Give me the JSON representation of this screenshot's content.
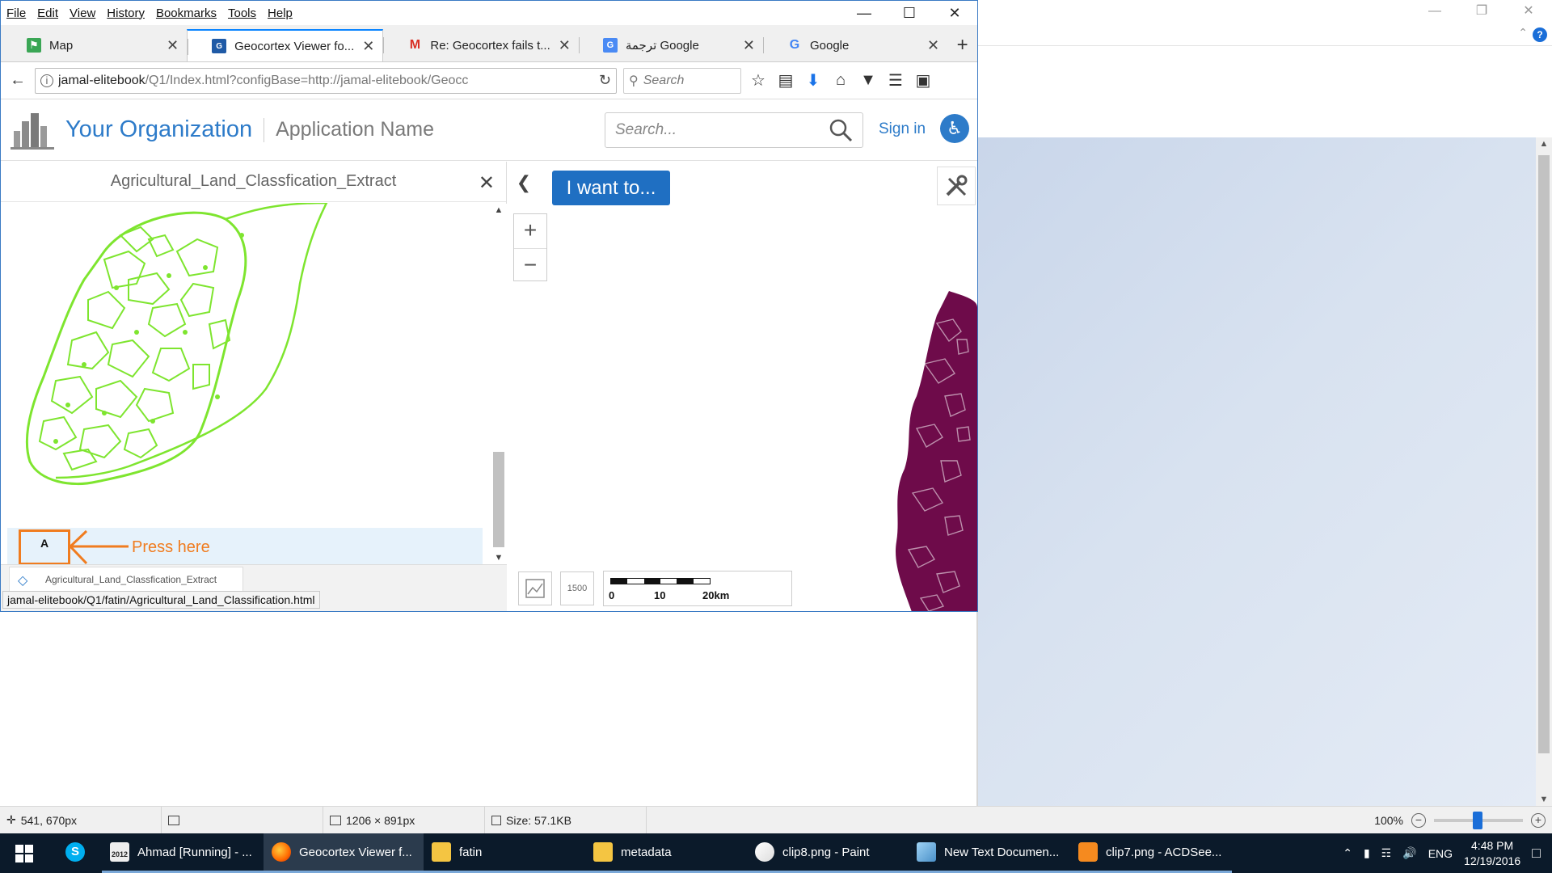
{
  "firefox": {
    "menu": [
      "File",
      "Edit",
      "View",
      "History",
      "Bookmarks",
      "Tools",
      "Help"
    ],
    "tabs": [
      {
        "label": "Map",
        "icon": "map-icon"
      },
      {
        "label": "Geocortex Viewer fo...",
        "icon": "geocortex-icon",
        "active": true
      },
      {
        "label": "Re: Geocortex fails t...",
        "icon": "gmail-icon"
      },
      {
        "label": "ترجمة Google",
        "icon": "google-translate-icon"
      },
      {
        "label": "Google",
        "icon": "google-icon"
      }
    ],
    "url_host": "jamal-elitebook",
    "url_rest": "/Q1/Index.html?configBase=http://jamal-elitebook/Geocc",
    "search_placeholder": "Search"
  },
  "app": {
    "org_name": "Your Organization",
    "app_name": "Application Name",
    "search_placeholder": "Search...",
    "sign_in": "Sign in",
    "panel_title": "Agricultural_Land_Classfication_Extract",
    "layer_tab_label": "Agricultural_Land_Classfication_Extract",
    "annotation_box": "A",
    "annotation_text": "Press here",
    "i_want_to": "I want to...",
    "scale_labels": [
      "0",
      "10",
      "20km"
    ],
    "scale_btn_label": "1500",
    "status_url": "jamal-elitebook/Q1/fatin/Agricultural_Land_Classification.html",
    "colors": {
      "accent": "#2d7bc9",
      "green_parcels": "#7ee52f",
      "maroon_parcels": "#6e0b4a",
      "annotation": "#f07c1f"
    }
  },
  "viewer_status": {
    "cursor_pos": "541, 670px",
    "dimensions": "1206 × 891px",
    "size": "Size: 57.1KB",
    "zoom": "100%"
  },
  "taskbar": {
    "items": [
      {
        "label": "Ahmad [Running] - ...",
        "icon": "virtualbox-icon"
      },
      {
        "label": "Geocortex Viewer f...",
        "icon": "firefox-icon",
        "active": true
      },
      {
        "label": "fatin",
        "icon": "folder-icon"
      },
      {
        "label": "metadata",
        "icon": "folder-icon"
      },
      {
        "label": "clip8.png - Paint",
        "icon": "paint-icon"
      },
      {
        "label": "New Text Documen...",
        "icon": "notepad-icon"
      },
      {
        "label": "clip7.png - ACDSee...",
        "icon": "acdsee-icon"
      }
    ],
    "year_badge": "2012",
    "language": "ENG",
    "time": "4:48 PM",
    "date": "12/19/2016"
  }
}
